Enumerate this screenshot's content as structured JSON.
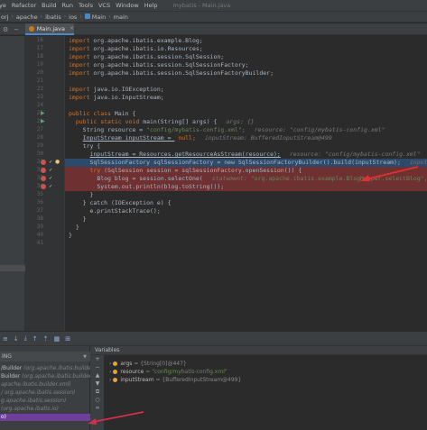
{
  "menubar": {
    "items": [
      "ye",
      "Refactor",
      "Build",
      "Run",
      "Tools",
      "VCS",
      "Window",
      "Help"
    ],
    "window_title": "mybatis - Main.java"
  },
  "breadcrumb": {
    "items": [
      "orj",
      "apache",
      "ibatis",
      "ios",
      "Main",
      "main"
    ]
  },
  "tabs": {
    "active_label": "Main.java",
    "close_glyph": "×"
  },
  "gutter": {
    "line_numbers": [
      "16",
      "17",
      "18",
      "19",
      "20",
      "21",
      "22",
      "23",
      "24",
      "25",
      "26",
      "27",
      "28",
      "29",
      "30",
      "31",
      "32",
      "33",
      "34",
      "35",
      "36",
      "37",
      "38",
      "39",
      "40",
      "41"
    ]
  },
  "editor": {
    "lines": [
      {
        "kw": "import ",
        "rest": "org.apache.ibatis.example.Blog;"
      },
      {
        "kw": "import ",
        "rest": "org.apache.ibatis.io.Resources;"
      },
      {
        "kw": "import ",
        "rest": "org.apache.ibatis.session.SqlSession;"
      },
      {
        "kw": "import ",
        "rest": "org.apache.ibatis.session.SqlSessionFactory;"
      },
      {
        "kw": "import ",
        "rest": "org.apache.ibatis.session.SqlSessionFactoryBuilder;"
      },
      {
        "kw": "",
        "rest": ""
      },
      {
        "kw": "import ",
        "rest": "java.io.IOException;"
      },
      {
        "kw": "import ",
        "rest": "java.io.InputStream;"
      },
      {
        "kw": "",
        "rest": ""
      },
      {
        "kw": "public class ",
        "rest": "Main {"
      },
      {
        "kw": "  public static void ",
        "rest": "main(String[] args) {",
        "hint": "args: {}"
      },
      {
        "kw": "    ",
        "rest": "String resource = ",
        "str": "\"config/mybatis-config.xml\";",
        "hint": "resource: \"config/mybatis-config.xml\""
      },
      {
        "kw": "    ",
        "rest": "InputStream inputStream = ",
        "kw2": "null;",
        "hint": "inputStream: BufferedInputStream@499"
      },
      {
        "kw": "    ",
        "rest": "try {"
      },
      {
        "kw": "      ",
        "rest": "inputStream = Resources.getResourceAsStream(resource);",
        "hint": "resource: \"config/mybatis-config.xml\""
      },
      {
        "kw": "      ",
        "rest": "SqlSessionFactory sqlSessionFactory = new SqlSessionFactoryBuilder().build(inputStream);",
        "hint": "inputStream"
      },
      {
        "kw": "      try ",
        "rest": "(SqlSession session = sqlSessionFactory.openSession()) {"
      },
      {
        "kw": "        ",
        "rest": "Blog blog = session.selectOne(",
        "hint2": "statement:",
        "str": " \"org.apache.ibatis.example.BlogMapper.selectBlog\",",
        "hint": "parameter:"
      },
      {
        "kw": "        ",
        "rest": "System.out.println(blog.toString());"
      },
      {
        "kw": "      ",
        "rest": "}"
      },
      {
        "kw": "    ",
        "rest": "} catch (IOException e) {"
      },
      {
        "kw": "      ",
        "rest": "e.printStackTrace();"
      },
      {
        "kw": "    ",
        "rest": "}"
      },
      {
        "kw": "  ",
        "rest": "}"
      },
      {
        "kw": "",
        "rest": "}"
      },
      {
        "kw": "",
        "rest": ""
      }
    ]
  },
  "debug": {
    "toolbar_icons": [
      "≡",
      "↓",
      "⤓",
      "↑",
      "⇡",
      "▦",
      "⊞"
    ],
    "frames_header": "ING",
    "frames": [
      {
        "name": "/Builder",
        "loc": " (org.apache.ibatis.builder"
      },
      {
        "name": "Builder",
        "loc": " (org.apache.ibatis.builder.x"
      },
      {
        "name": "",
        "loc": "apache.ibatis.builder.xml)"
      },
      {
        "name": "",
        "loc": "/ org.apache.ibatis.session)"
      },
      {
        "name": "",
        "loc": "g.apache.ibatis.session)"
      },
      {
        "name": "",
        "loc": "(org.apache.ibatis.io)"
      },
      {
        "name": "o)",
        "loc": "",
        "selected": true
      }
    ],
    "variables_title": "Variables",
    "var_tools": [
      "+",
      "−",
      "▲",
      "▼",
      "⧉",
      "○",
      "∞"
    ],
    "variables": [
      {
        "name": "args",
        "value": " = {String[0]@447}"
      },
      {
        "name": "resource",
        "value": " = \"config/mybatis-config.xml\""
      },
      {
        "name": "inputStream",
        "value": " = {BufferedInputStream@499}"
      }
    ]
  }
}
